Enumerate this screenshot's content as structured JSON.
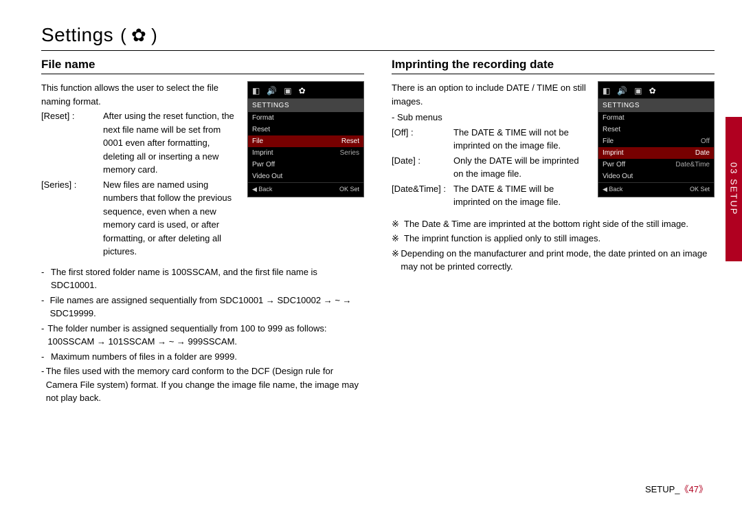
{
  "title": "Settings",
  "gear_glyph": "(  ✿  )",
  "left": {
    "heading": "File name",
    "intro": "This function allows the user to select the ﬁle naming format.",
    "options": [
      {
        "label": "[Reset]",
        "colon": ":",
        "desc": "After using the reset function, the next ﬁle name will be set from 0001 even after formatting, deleting all or inserting a new memory card."
      },
      {
        "label": "[Series]",
        "colon": ":",
        "desc": "New ﬁles are named using numbers that follow the previous sequence, even when a new memory card is used, or after formatting, or after deleting all pictures."
      }
    ],
    "bullets": [
      "The ﬁrst stored folder name is 100SSCAM, and the ﬁrst ﬁle name is SDC10001.",
      "File names are assigned sequentially from SDC10001 → SDC10002 → ~ → SDC19999.",
      "The folder number is assigned sequentially from 100 to 999 as follows: 100SSCAM → 101SSCAM → ~ → 999SSCAM.",
      "Maximum numbers of ﬁles in a folder are 9999.",
      "The ﬁles used with the memory card conform to the DCF (Design rule for Camera File system) format. If you change the image ﬁle name, the image may not play back."
    ],
    "lcd": {
      "head": "SETTINGS",
      "rows": [
        {
          "l": "Format",
          "r": ""
        },
        {
          "l": "Reset",
          "r": ""
        },
        {
          "l": "File",
          "r": "Reset",
          "hl": true
        },
        {
          "l": "Imprint",
          "r": "Series"
        },
        {
          "l": "Pwr Off",
          "r": ""
        },
        {
          "l": "Video Out",
          "r": ""
        }
      ],
      "foot_l": "◀ Back",
      "foot_r": "OK Set"
    }
  },
  "right": {
    "heading": "Imprinting the recording date",
    "intro": "There is an option to include DATE / TIME on still images.",
    "submenus_label": "- Sub menus",
    "options": [
      {
        "label": "[Off]",
        "colon": ":",
        "desc": "The DATE & TIME will not be imprinted on the image ﬁle."
      },
      {
        "label": "[Date]",
        "colon": ":",
        "desc": "Only the DATE will be imprinted on the image ﬁle."
      },
      {
        "label": "[Date&Time]",
        "colon": ":",
        "desc": "The DATE & TIME will be imprinted on the image ﬁle."
      }
    ],
    "notes": [
      "The Date & Time are imprinted at the bottom right side of the still image.",
      "The imprint function is applied only to still images.",
      "Depending on the manufacturer and print mode, the date printed on an image may not be printed correctly."
    ],
    "lcd": {
      "head": "SETTINGS",
      "rows": [
        {
          "l": "Format",
          "r": ""
        },
        {
          "l": "Reset",
          "r": ""
        },
        {
          "l": "File",
          "r": "Off"
        },
        {
          "l": "Imprint",
          "r": "Date",
          "hl": true
        },
        {
          "l": "Pwr Off",
          "r": "Date&Time"
        },
        {
          "l": "Video Out",
          "r": ""
        }
      ],
      "foot_l": "◀ Back",
      "foot_r": "OK Set"
    }
  },
  "side_tab": "03 SETUP",
  "footer_label": "SETUP_",
  "footer_glyph": "《47》",
  "note_glyph": "※",
  "lcd_icons": [
    "◧",
    "🔊",
    "▣",
    "✿"
  ]
}
